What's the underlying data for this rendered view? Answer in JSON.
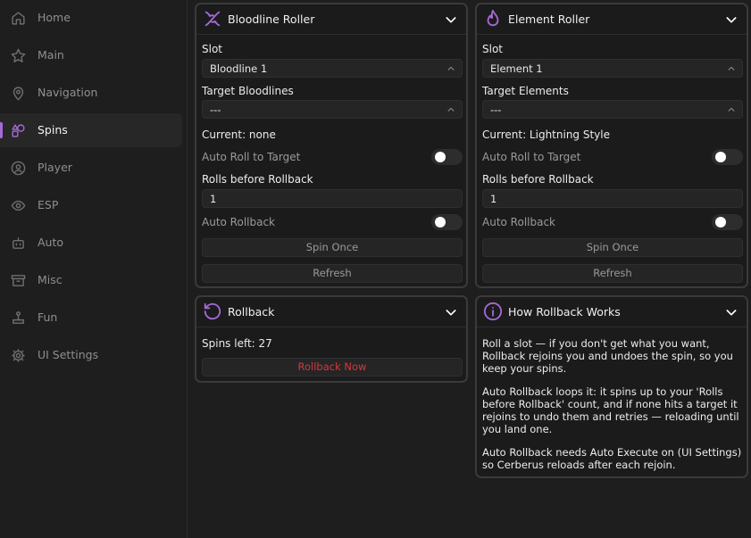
{
  "sidebar": {
    "items": [
      {
        "label": "Home",
        "icon": "home-icon"
      },
      {
        "label": "Main",
        "icon": "star-icon"
      },
      {
        "label": "Navigation",
        "icon": "map-pin-icon"
      },
      {
        "label": "Spins",
        "icon": "shapes-icon",
        "active": true
      },
      {
        "label": "Player",
        "icon": "user-icon"
      },
      {
        "label": "ESP",
        "icon": "eye-icon"
      },
      {
        "label": "Auto",
        "icon": "bot-icon"
      },
      {
        "label": "Misc",
        "icon": "archive-icon"
      },
      {
        "label": "Fun",
        "icon": "joystick-icon"
      },
      {
        "label": "UI Settings",
        "icon": "gear-icon"
      }
    ]
  },
  "bloodline": {
    "title": "Bloodline Roller",
    "slot_label": "Slot",
    "slot_value": "Bloodline 1",
    "target_label": "Target Bloodlines",
    "target_value": "---",
    "current": "Current: none",
    "auto_roll_label": "Auto Roll to Target",
    "auto_roll_on": false,
    "rolls_label": "Rolls before Rollback",
    "rolls_value": "1",
    "auto_rollback_label": "Auto Rollback",
    "auto_rollback_on": false,
    "spin_once": "Spin Once",
    "refresh": "Refresh"
  },
  "element": {
    "title": "Element Roller",
    "slot_label": "Slot",
    "slot_value": "Element 1",
    "target_label": "Target Elements",
    "target_value": "---",
    "current": "Current: Lightning Style",
    "auto_roll_label": "Auto Roll to Target",
    "auto_roll_on": false,
    "rolls_label": "Rolls before Rollback",
    "rolls_value": "1",
    "auto_rollback_label": "Auto Rollback",
    "auto_rollback_on": false,
    "spin_once": "Spin Once",
    "refresh": "Refresh"
  },
  "rollback": {
    "title": "Rollback",
    "spins_left": "Spins left: 27",
    "rollback_now": "Rollback Now"
  },
  "howto": {
    "title": "How Rollback Works",
    "paragraphs": [
      "Roll a slot — if you don't get what you want, Rollback rejoins you and undoes the spin, so you keep your spins.",
      "Auto Rollback loops it: it spins up to your 'Rolls before Rollback' count, and if none hits a target it rejoins to undo them and retries — reloading until you land one.",
      "Auto Rollback needs Auto Execute on (UI Settings) so Cerberus reloads after each rejoin."
    ]
  },
  "colors": {
    "accent": "#a46ad6",
    "danger": "#d2393d",
    "background": "#1e1e1e",
    "panel": "#1b1b1b"
  }
}
